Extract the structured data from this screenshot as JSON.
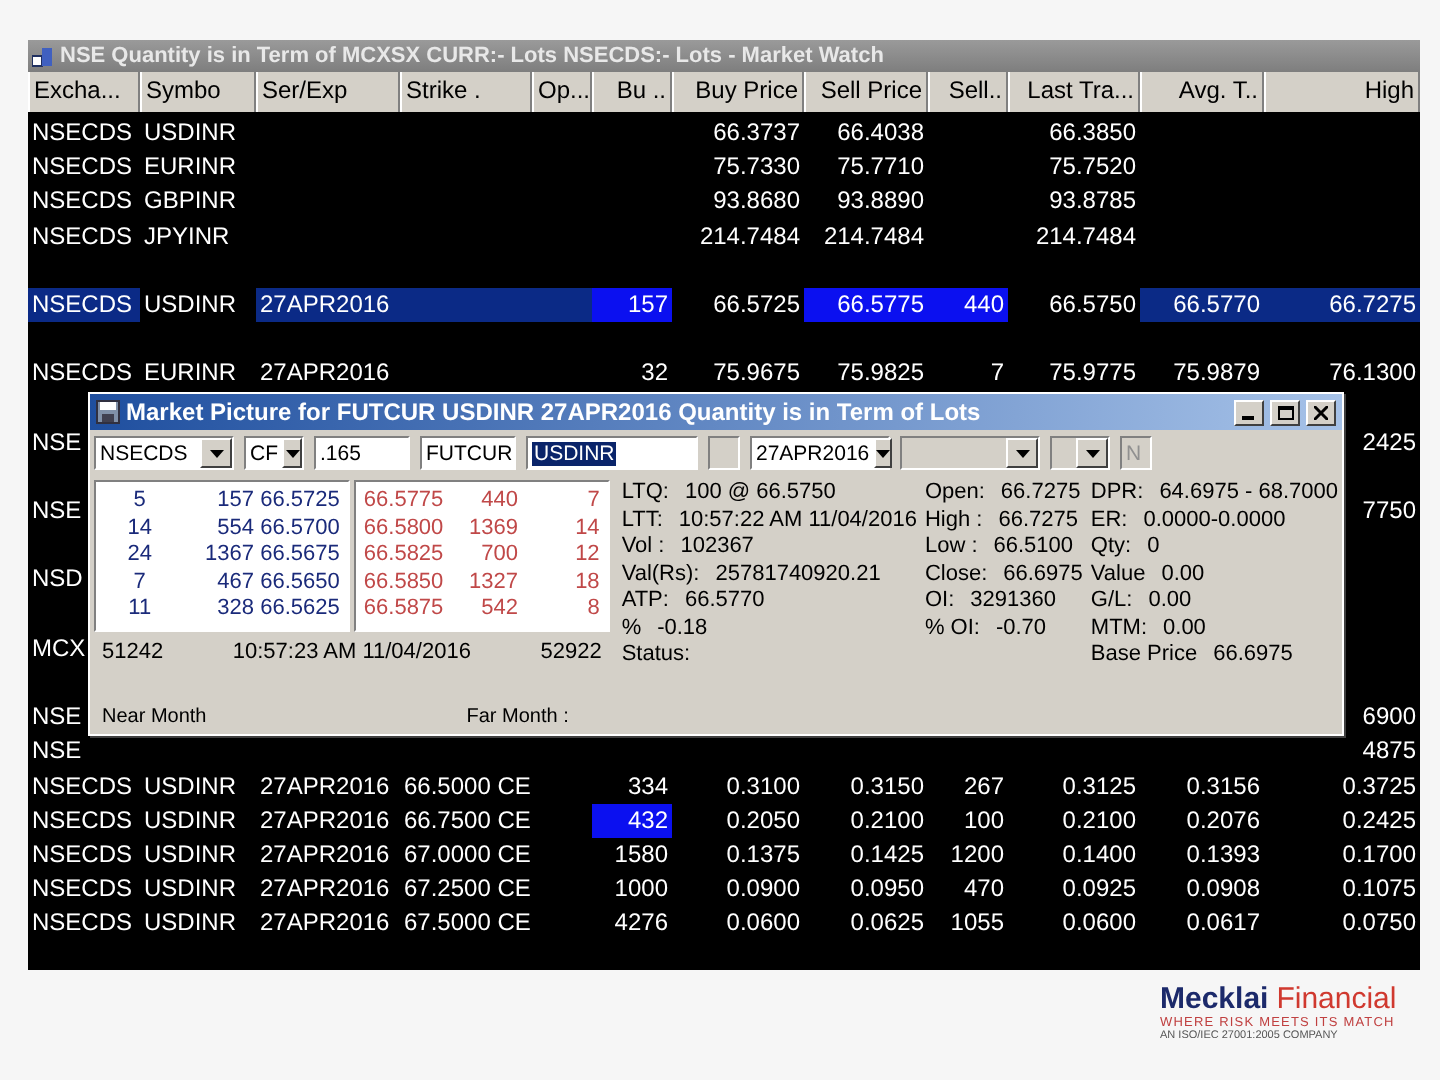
{
  "market_watch": {
    "title": "NSE  Quantity is in Term of  MCXSX CURR:- Lots NSECDS:- Lots - Market Watch",
    "columns": [
      "Excha...",
      "Symbo",
      "Ser/Exp",
      "Strike .",
      "Op...",
      "Bu ..",
      "Buy Price",
      "Sell Price",
      "Sell..",
      "Last Tra...",
      "Avg. T..",
      "High"
    ],
    "rows": [
      {
        "kind": "data",
        "cells": [
          "NSECDS",
          "USDINR",
          null,
          null,
          null,
          null,
          "66.3737",
          "66.4038",
          null,
          "66.3850"
        ]
      },
      {
        "kind": "data",
        "cells": [
          "NSECDS",
          "EURINR",
          null,
          null,
          null,
          null,
          "75.7330",
          "75.7710",
          null,
          "75.7520"
        ]
      },
      {
        "kind": "data",
        "cells": [
          "NSECDS",
          "GBPINR",
          null,
          null,
          null,
          null,
          "93.8680",
          "93.8890",
          null,
          "93.8785"
        ]
      },
      {
        "kind": "data",
        "cells": [
          "NSECDS",
          "JPYINR",
          null,
          null,
          null,
          null,
          "214.7484",
          "214.7484",
          null,
          "214.7484"
        ]
      },
      {
        "kind": "blank"
      },
      {
        "kind": "data",
        "cells": [
          {
            "text": "NSECDS",
            "selected": true
          },
          "USDINR",
          {
            "text": "27APR2016",
            "selected": true
          },
          {
            "selected": true
          },
          {
            "selected": true
          },
          {
            "text": "157",
            "changed": true
          },
          "66.5725",
          {
            "text": "66.5775",
            "changed": true
          },
          {
            "text": "440",
            "changed": true
          },
          "66.5750",
          {
            "text": "66.5770",
            "selected": true
          },
          {
            "text": "66.7275",
            "selected": true
          }
        ]
      },
      {
        "kind": "blank"
      },
      {
        "kind": "data",
        "cells": [
          "NSECDS",
          "EURINR",
          "27APR2016",
          null,
          null,
          "32",
          "75.9675",
          "75.9825",
          "7",
          "75.9775",
          "75.9879",
          "76.1300"
        ]
      },
      {
        "kind": "blank"
      },
      {
        "kind": "data",
        "cells": [
          "NSE",
          null,
          null,
          null,
          null,
          null,
          null,
          null,
          null,
          null,
          null,
          "2425"
        ]
      },
      {
        "kind": "blank"
      },
      {
        "kind": "data",
        "cells": [
          "NSE",
          null,
          null,
          null,
          null,
          null,
          null,
          null,
          null,
          null,
          null,
          "7750"
        ]
      },
      {
        "kind": "blank"
      },
      {
        "kind": "data",
        "cells": [
          "NSD"
        ]
      },
      {
        "kind": "blank"
      },
      {
        "kind": "data",
        "cells": [
          "MCX"
        ]
      },
      {
        "kind": "blank"
      },
      {
        "kind": "data",
        "cells": [
          "NSE",
          null,
          null,
          null,
          null,
          null,
          null,
          null,
          null,
          null,
          null,
          "6900"
        ]
      },
      {
        "kind": "data",
        "cells": [
          "NSE",
          null,
          null,
          null,
          null,
          null,
          null,
          null,
          null,
          null,
          null,
          "4875"
        ]
      },
      {
        "kind": "data",
        "cells": [
          "NSECDS",
          "USDINR",
          "27APR2016",
          "66.5000 CE",
          null,
          "334",
          "0.3100",
          "0.3150",
          "267",
          "0.3125",
          "0.3156",
          "0.3725"
        ]
      },
      {
        "kind": "data",
        "cells": [
          "NSECDS",
          "USDINR",
          "27APR2016",
          "66.7500 CE",
          null,
          {
            "text": "432",
            "changed": true
          },
          "0.2050",
          "0.2100",
          "100",
          "0.2100",
          "0.2076",
          "0.2425"
        ]
      },
      {
        "kind": "data",
        "cells": [
          "NSECDS",
          "USDINR",
          "27APR2016",
          "67.0000 CE",
          null,
          "1580",
          "0.1375",
          "0.1425",
          "1200",
          "0.1400",
          "0.1393",
          "0.1700"
        ]
      },
      {
        "kind": "data",
        "cells": [
          "NSECDS",
          "USDINR",
          "27APR2016",
          "67.2500 CE",
          null,
          "1000",
          "0.0900",
          "0.0950",
          "470",
          "0.0925",
          "0.0908",
          "0.1075"
        ]
      },
      {
        "kind": "data",
        "cells": [
          "NSECDS",
          "USDINR",
          "27APR2016",
          "67.5000 CE",
          null,
          "4276",
          "0.0600",
          "0.0625",
          "1055",
          "0.0600",
          "0.0617",
          "0.0750"
        ]
      }
    ]
  },
  "market_picture": {
    "title": "Market Picture for FUTCUR USDINR 27APR2016  Quantity is in Term of Lots",
    "controls": [
      {
        "kind": "combo",
        "value": "NSECDS"
      },
      {
        "kind": "combo",
        "value": "CF"
      },
      {
        "kind": "field",
        "value": ".165"
      },
      {
        "kind": "field",
        "value": "FUTCUR"
      },
      {
        "kind": "field",
        "value": "USDINR",
        "selected": true
      },
      {
        "kind": "field",
        "disabled": true
      },
      {
        "kind": "combo",
        "value": "27APR2016"
      },
      {
        "kind": "combo",
        "disabled": true
      },
      {
        "kind": "combo",
        "disabled": true
      },
      {
        "kind": "field",
        "value": "N",
        "disabled": true
      }
    ],
    "bids": [
      [
        "5",
        "157",
        "66.5725"
      ],
      [
        "14",
        "554",
        "66.5700"
      ],
      [
        "24",
        "1367",
        "66.5675"
      ],
      [
        "7",
        "467",
        "66.5650"
      ],
      [
        "11",
        "328",
        "66.5625"
      ]
    ],
    "asks": [
      [
        "66.5775",
        "440",
        "7"
      ],
      [
        "66.5800",
        "1369",
        "14"
      ],
      [
        "66.5825",
        "700",
        "12"
      ],
      [
        "66.5850",
        "1327",
        "18"
      ],
      [
        "66.5875",
        "542",
        "8"
      ]
    ],
    "totals": {
      "bid_qty": "51242",
      "time": "10:57:23 AM 11/04/2016",
      "ask_qty": "52922"
    },
    "stats": [
      [
        {
          "label": "LTQ:",
          "value": "100 @ 66.5750"
        },
        {
          "label": "LTT:",
          "value": "10:57:22 AM 11/04/2016"
        },
        {
          "label": "Vol :",
          "value": "102367"
        },
        {
          "label": "Val(Rs):",
          "value": "25781740920.21"
        },
        {
          "label": "ATP:",
          "value": "66.5770"
        },
        {
          "label": "%",
          "value": "-0.18"
        },
        {
          "label": "Status:"
        }
      ],
      [
        {
          "label": "Open:",
          "value": "66.7275"
        },
        {
          "label": "High :",
          "value": "66.7275"
        },
        {
          "label": "Low :",
          "value": "66.5100"
        },
        {
          "label": "Close:",
          "value": "66.6975"
        },
        {
          "label": "OI:",
          "value": "3291360"
        },
        {
          "label": "% OI:",
          "value": "-0.70"
        }
      ],
      [
        {
          "label": "DPR:",
          "value": "64.6975 - 68.7000"
        },
        {
          "label": "ER:",
          "value": "0.0000-0.0000"
        },
        {
          "label": "Qty:",
          "value": "0"
        },
        {
          "label": "Value",
          "value": "0.00"
        },
        {
          "label": "G/L:",
          "value": "0.00"
        },
        {
          "label": "MTM:",
          "value": "0.00"
        },
        {
          "label": "Base Price",
          "value": "66.6975"
        }
      ]
    ],
    "footer": [
      "Near Month",
      "Far Month :"
    ]
  },
  "brand": {
    "name_first": "Mecklai",
    "name_second": "Financial",
    "tagline": "WHERE RISK MEETS ITS MATCH",
    "note": "AN ISO/IEC 27001:2005 COMPANY"
  }
}
